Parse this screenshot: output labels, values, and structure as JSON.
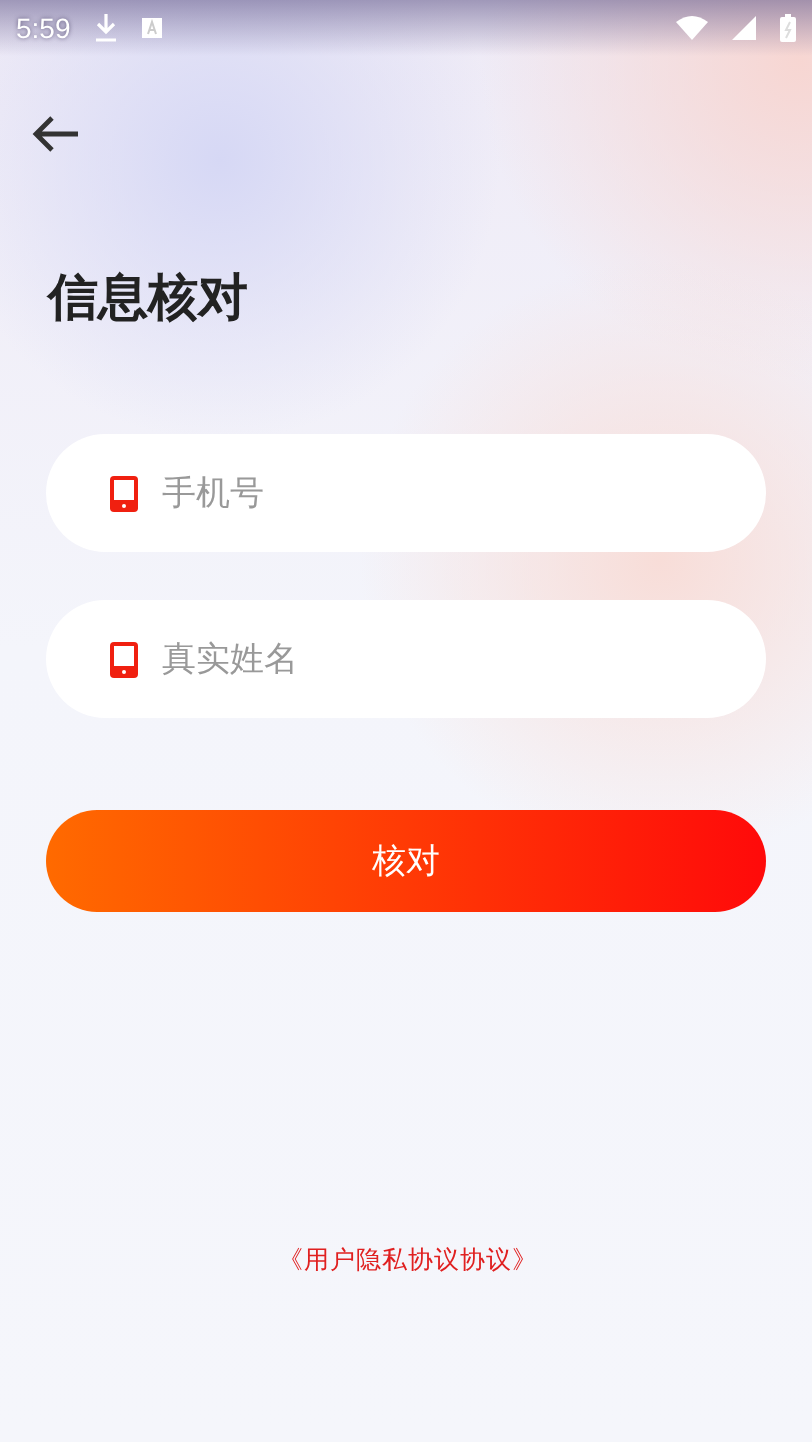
{
  "status_bar": {
    "time": "5:59"
  },
  "title": "信息核对",
  "fields": [
    {
      "placeholder": "手机号"
    },
    {
      "placeholder": "真实姓名"
    }
  ],
  "button": {
    "label": "核对"
  },
  "agreement": "《用户隐私协议协议》"
}
